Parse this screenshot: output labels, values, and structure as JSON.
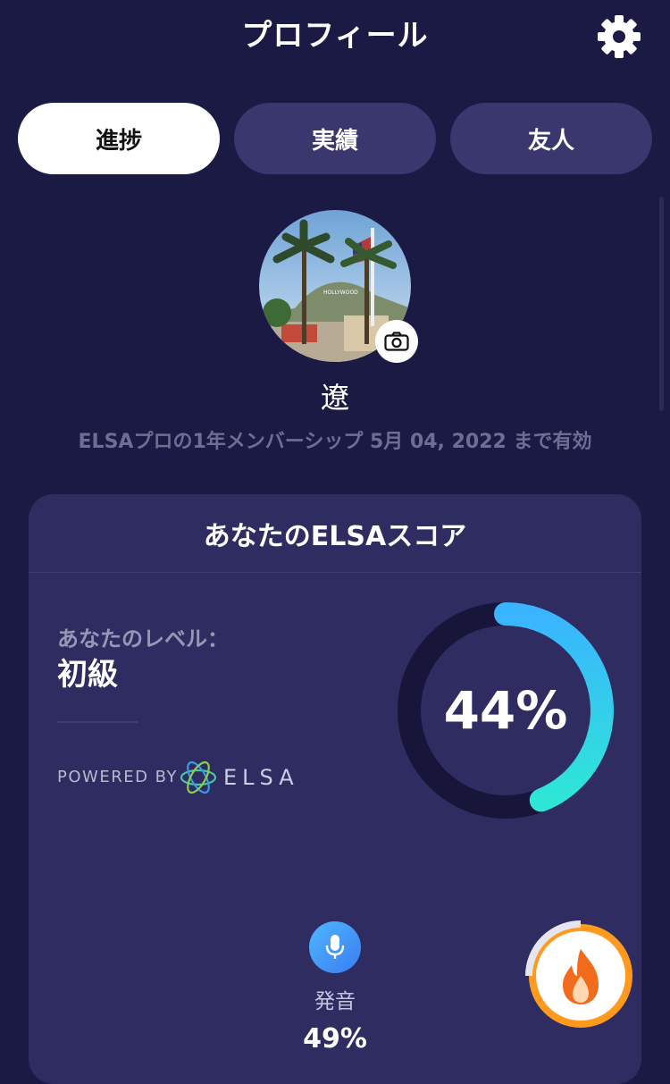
{
  "header": {
    "title": "プロフィール",
    "settings_icon": "gear-icon"
  },
  "tabs": [
    {
      "label": "進捗",
      "active": true
    },
    {
      "label": "実績",
      "active": false
    },
    {
      "label": "友人",
      "active": false
    }
  ],
  "profile": {
    "name": "遼",
    "membership": "ELSAプロの1年メンバーシップ 5月 04, 2022 まで有効",
    "camera_icon": "camera-icon"
  },
  "score_card": {
    "title": "あなたのELSAスコア",
    "level_label": "あなたのレベル：",
    "level_value": "初級",
    "powered_by": "POWERED BY",
    "brand": "ELSA",
    "score_text": "44%",
    "score_value": 44,
    "skill": {
      "icon": "microphone-icon",
      "label": "発音",
      "value": "49%"
    }
  },
  "streak": {
    "icon": "flame-icon"
  },
  "colors": {
    "background": "#1b1a45",
    "card": "#2f2c62",
    "gauge_start": "#3ab4ff",
    "gauge_end": "#2ee6d6",
    "streak_ring": "#ff9a1f"
  }
}
